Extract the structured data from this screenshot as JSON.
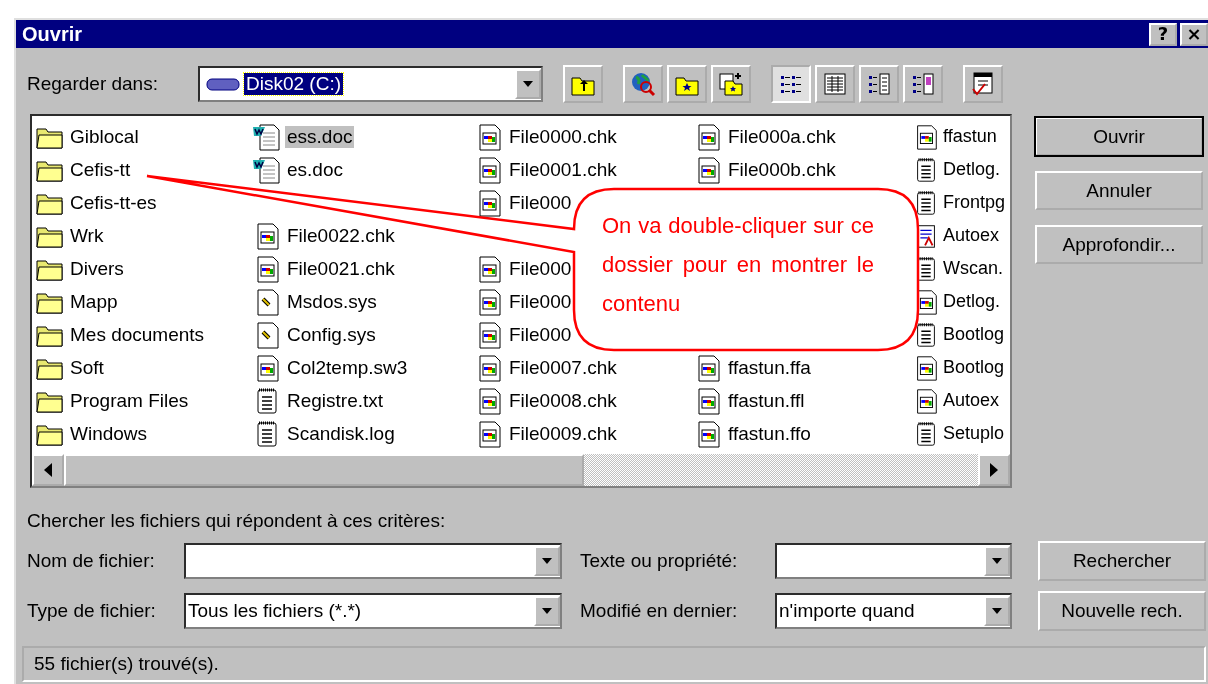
{
  "window": {
    "title": "Ouvrir",
    "title_buttons": [
      "?",
      "×"
    ]
  },
  "look_in": {
    "label": "Regarder dans:",
    "value": "Disk02 (C:)"
  },
  "toolbar": [
    [
      {
        "kind": "up",
        "pressed": false
      }
    ],
    [
      {
        "kind": "web",
        "pressed": false
      },
      {
        "kind": "favorites",
        "pressed": false
      },
      {
        "kind": "add-favorite",
        "pressed": false
      }
    ],
    [
      {
        "kind": "list",
        "pressed": true
      },
      {
        "kind": "details",
        "pressed": false
      },
      {
        "kind": "properties",
        "pressed": false
      },
      {
        "kind": "preview",
        "pressed": false
      }
    ],
    [
      {
        "kind": "commands",
        "pressed": false
      }
    ]
  ],
  "files": [
    [
      {
        "name": "Giblocal",
        "kind": "folder",
        "selected": false
      },
      {
        "name": "Cefis-tt",
        "kind": "folder",
        "selected": false
      },
      {
        "name": "Cefis-tt-es",
        "kind": "folder",
        "selected": false
      },
      {
        "name": "Wrk",
        "kind": "folder",
        "selected": false
      },
      {
        "name": "Divers",
        "kind": "folder",
        "selected": false
      },
      {
        "name": "Mapp",
        "kind": "folder",
        "selected": false
      },
      {
        "name": "Mes documents",
        "kind": "folder",
        "selected": false
      },
      {
        "name": "Soft",
        "kind": "folder",
        "selected": false
      },
      {
        "name": "Program Files",
        "kind": "folder",
        "selected": false
      },
      {
        "name": "Windows",
        "kind": "folder",
        "selected": false
      }
    ],
    [
      {
        "name": "ess.doc",
        "kind": "word",
        "selected": true
      },
      {
        "name": "es.doc",
        "kind": "word",
        "selected": false
      },
      {
        "kind": "covered"
      },
      {
        "name": "File0022.chk",
        "kind": "program",
        "selected": false
      },
      {
        "name": "File0021.chk",
        "kind": "program",
        "selected": false
      },
      {
        "name": "Msdos.sys",
        "kind": "settings",
        "selected": false
      },
      {
        "name": "Config.sys",
        "kind": "settings",
        "selected": false
      },
      {
        "name": "Col2temp.sw3",
        "kind": "program",
        "selected": false
      },
      {
        "name": "Registre.txt",
        "kind": "text",
        "selected": false
      },
      {
        "name": "Scandisk.log",
        "kind": "text",
        "selected": false
      }
    ],
    [
      {
        "name": "File0000.chk",
        "kind": "program",
        "selected": false
      },
      {
        "name": "File0001.chk",
        "kind": "program",
        "selected": false
      },
      {
        "name": "File000",
        "kind": "program",
        "selected": false
      },
      {
        "kind": "covered"
      },
      {
        "name": "File000",
        "kind": "program",
        "selected": false
      },
      {
        "name": "File000",
        "kind": "program",
        "selected": false
      },
      {
        "name": "File000",
        "kind": "program",
        "selected": false
      },
      {
        "name": "File0007.chk",
        "kind": "program",
        "selected": false
      },
      {
        "name": "File0008.chk",
        "kind": "program",
        "selected": false
      },
      {
        "name": "File0009.chk",
        "kind": "program",
        "selected": false
      }
    ],
    [
      {
        "name": "File000a.chk",
        "kind": "program",
        "selected": false
      },
      {
        "name": "File000b.chk",
        "kind": "program",
        "selected": false
      },
      {
        "kind": "covered"
      },
      {
        "kind": "covered"
      },
      {
        "kind": "covered"
      },
      {
        "kind": "covered"
      },
      {
        "kind": "covered"
      },
      {
        "name": "ffastun.ffa",
        "kind": "program",
        "selected": false
      },
      {
        "name": "ffastun.ffl",
        "kind": "program",
        "selected": false
      },
      {
        "name": "ffastun.ffo",
        "kind": "program",
        "selected": false
      }
    ],
    [
      {
        "name": "ffastun",
        "kind": "program",
        "selected": false
      },
      {
        "name": "Detlog.",
        "kind": "text",
        "selected": false
      },
      {
        "name": "Frontpg",
        "kind": "text",
        "selected": false
      },
      {
        "name": "Autoex",
        "kind": "script",
        "selected": false
      },
      {
        "name": "Wscan.",
        "kind": "text",
        "selected": false
      },
      {
        "name": "Detlog.",
        "kind": "program",
        "selected": false
      },
      {
        "name": "Bootlog",
        "kind": "text",
        "selected": false
      },
      {
        "name": "Bootlog",
        "kind": "program",
        "selected": false
      },
      {
        "name": "Autoex",
        "kind": "program",
        "selected": false
      },
      {
        "name": "Setuplo",
        "kind": "text",
        "selected": false
      }
    ]
  ],
  "buttons": [
    {
      "label": "Ouvrir",
      "default": true
    },
    {
      "label": "Annuler",
      "default": false
    },
    {
      "label": "Approfondir...",
      "default": false
    }
  ],
  "search": {
    "heading": "Chercher les fichiers qui répondent à ces critères:",
    "fields": [
      {
        "label": "Nom de fichier:"
      },
      {
        "label": "Texte ou propriété:"
      },
      {
        "label": "Type de fichier:",
        "value": "Tous les fichiers (*.*)"
      },
      {
        "label": "Modifié en dernier:",
        "value": "n'importe quand"
      }
    ],
    "buttons": [
      "Rechercher",
      "Nouvelle rech."
    ]
  },
  "status_bar": "55 fichier(s) trouvé(s).",
  "callout": {
    "text": "On va double-cliquer sur ce dossier pour en montrer le contenu"
  }
}
